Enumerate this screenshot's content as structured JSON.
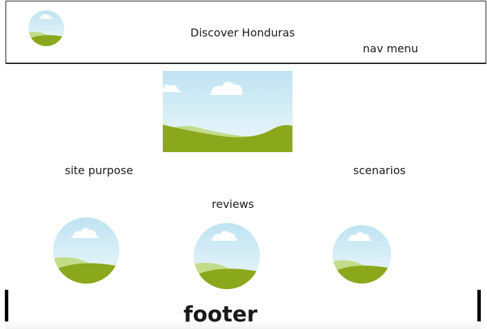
{
  "header": {
    "logo_icon": "image-placeholder-icon",
    "site_title": "Discover Honduras",
    "nav_label": "nav menu"
  },
  "hero": {
    "image_icon": "image-placeholder-icon"
  },
  "sections": {
    "purpose_label": "site purpose",
    "scenarios_label": "scenarios",
    "reviews_label": "reviews"
  },
  "reviews": [
    {
      "avatar_icon": "image-placeholder-icon"
    },
    {
      "avatar_icon": "image-placeholder-icon"
    },
    {
      "avatar_icon": "image-placeholder-icon"
    }
  ],
  "footer": {
    "label": "footer"
  },
  "colors": {
    "sky_top": "#bfe3f2",
    "sky_bottom": "#eef8fb",
    "hill_light": "#c2dc8a",
    "hill_dark": "#8ba81c",
    "cloud": "#ffffff",
    "border": "#222222"
  }
}
